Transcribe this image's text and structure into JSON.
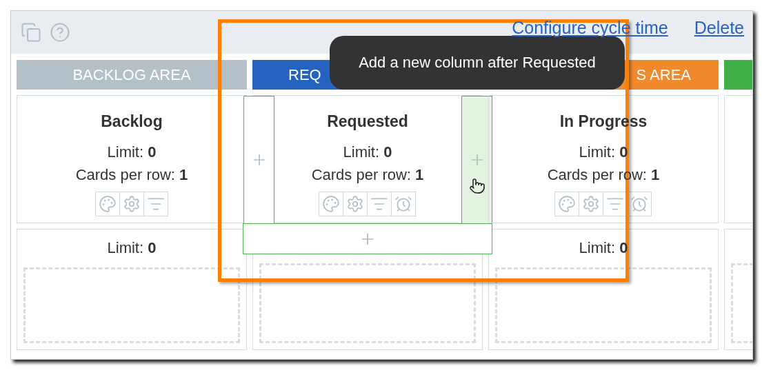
{
  "toolbar": {
    "links": [
      "Configure cycle time",
      "Delete"
    ]
  },
  "areas": [
    {
      "label": "BACKLOG AREA",
      "color": "#b4c0c8",
      "kind": "whole"
    },
    {
      "label": "REQ",
      "color": "#2563c0",
      "kind": "head"
    },
    {
      "label": "S AREA",
      "color": "#f08a2c",
      "kind": "tail"
    },
    {
      "color": "#3faf48",
      "kind": "whole"
    }
  ],
  "columns": [
    {
      "title": "Backlog",
      "limit": "Limit: **0**",
      "cards_per_row": "Cards per row: **1**",
      "tools": [
        {
          "kind": "palette"
        },
        {
          "kind": "settings"
        },
        {
          "kind": "filter"
        }
      ],
      "lane_limit": "Limit: **0**"
    },
    {
      "title": "Requested",
      "limit": "Limit: **0**",
      "cards_per_row": "Cards per row: **1**",
      "tools": [
        {
          "kind": "palette"
        },
        {
          "kind": "settings"
        },
        {
          "kind": "filter"
        },
        {
          "kind": "alarm"
        }
      ],
      "add_before": {
        "hovered": false
      },
      "add_after": {
        "hovered": true
      },
      "add_below": {
        "hovered": false
      }
    },
    {
      "title": "In Progress",
      "limit": "Limit: **0**",
      "cards_per_row": "Cards per row: **1**",
      "tools": [
        {
          "kind": "palette"
        },
        {
          "kind": "settings"
        },
        {
          "kind": "filter"
        },
        {
          "kind": "alarm"
        }
      ],
      "lane_limit": "Limit: **0**"
    },
    {}
  ],
  "tooltip": {
    "text": "Add a new column after Requested"
  }
}
